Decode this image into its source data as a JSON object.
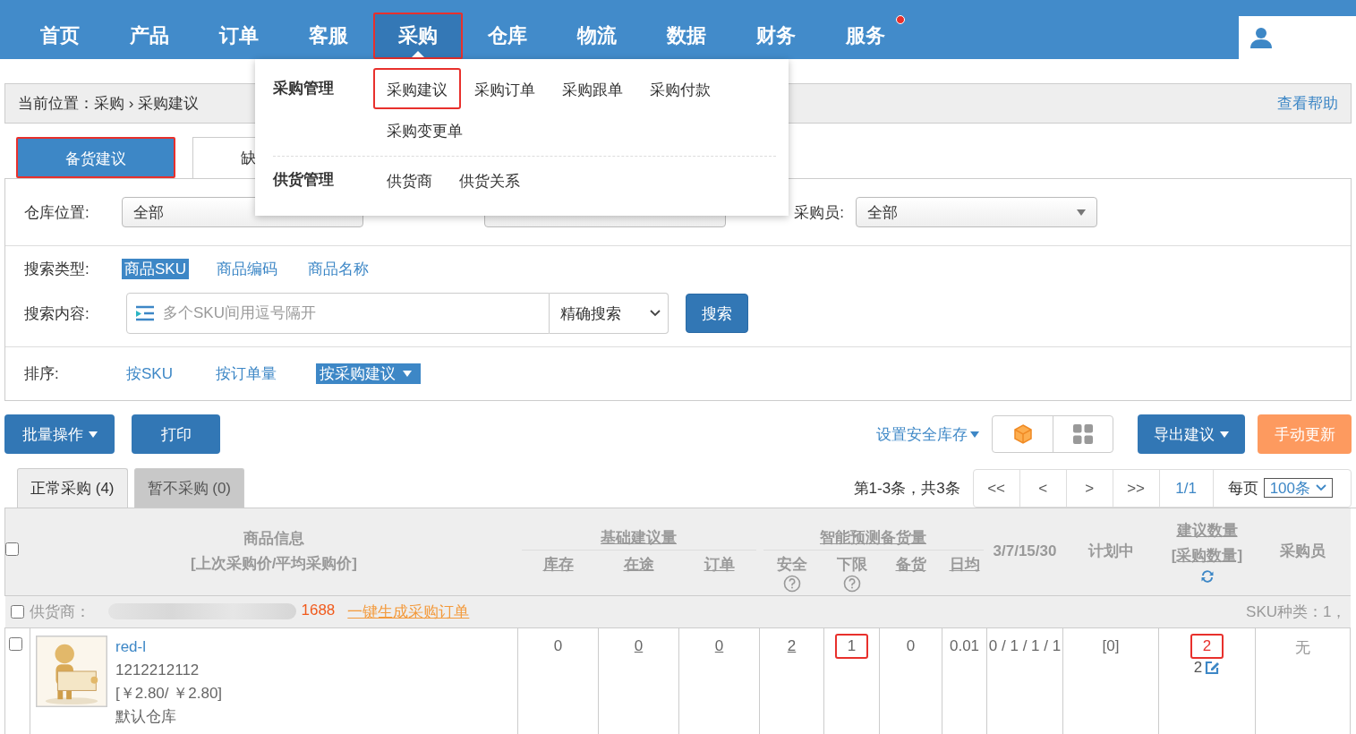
{
  "nav": {
    "items": [
      {
        "label": "首页",
        "selected": false,
        "highlighted": false,
        "dot": false
      },
      {
        "label": "产品",
        "selected": false,
        "highlighted": false,
        "dot": false
      },
      {
        "label": "订单",
        "selected": false,
        "highlighted": false,
        "dot": false
      },
      {
        "label": "客服",
        "selected": false,
        "highlighted": false,
        "dot": false
      },
      {
        "label": "采购",
        "selected": true,
        "highlighted": true,
        "dot": false
      },
      {
        "label": "仓库",
        "selected": false,
        "highlighted": false,
        "dot": false
      },
      {
        "label": "物流",
        "selected": false,
        "highlighted": false,
        "dot": false
      },
      {
        "label": "数据",
        "selected": false,
        "highlighted": false,
        "dot": false
      },
      {
        "label": "财务",
        "selected": false,
        "highlighted": false,
        "dot": false
      },
      {
        "label": "服务",
        "selected": false,
        "highlighted": false,
        "dot": true
      }
    ]
  },
  "menu": {
    "groups": [
      {
        "title": "采购管理",
        "items": [
          {
            "label": "采购建议",
            "highlighted": true
          },
          {
            "label": "采购订单",
            "highlighted": false
          },
          {
            "label": "采购跟单",
            "highlighted": false
          },
          {
            "label": "采购付款",
            "highlighted": false
          },
          {
            "label": "采购变更单",
            "highlighted": false
          }
        ]
      },
      {
        "title": "供货管理",
        "items": [
          {
            "label": "供货商",
            "highlighted": false
          },
          {
            "label": "供货关系",
            "highlighted": false
          }
        ]
      }
    ]
  },
  "breadcrumb": {
    "text": "当前位置：采购 › 采购建议",
    "help": "查看帮助"
  },
  "tabs": [
    {
      "label": "备货建议",
      "selected": true,
      "highlighted": true
    },
    {
      "label": "缺",
      "selected": false,
      "highlighted": false
    }
  ],
  "filters": [
    {
      "label": "仓库位置:",
      "value": "全部"
    },
    {
      "label": "采购员:",
      "value": "全部"
    }
  ],
  "search_type": {
    "label": "搜索类型:",
    "options": [
      {
        "label": "商品SKU",
        "selected": true
      },
      {
        "label": "商品编码",
        "selected": false
      },
      {
        "label": "商品名称",
        "selected": false
      }
    ]
  },
  "search": {
    "label": "搜索内容:",
    "placeholder": "多个SKU间用逗号隔开",
    "mode": "精确搜索",
    "button": "搜索"
  },
  "sort": {
    "label": "排序:",
    "options": [
      {
        "label": "按SKU",
        "selected": false
      },
      {
        "label": "按订单量",
        "selected": false
      },
      {
        "label": "按采购建议",
        "selected": true
      }
    ]
  },
  "toolbar": {
    "batch": "批量操作",
    "print": "打印",
    "safety_stock": "设置安全库存",
    "export": "导出建议",
    "refresh": "手动更新"
  },
  "subtabs": [
    {
      "label": "正常采购 (4)",
      "selected": true
    },
    {
      "label": "暂不采购 (0)",
      "selected": false
    }
  ],
  "pagination": {
    "summary": "第1-3条，共3条",
    "buttons": [
      "<<",
      "<",
      ">",
      ">>"
    ],
    "page": "1/1",
    "per_page_label": "每页",
    "per_page": "100条"
  },
  "table": {
    "header": [
      {
        "kind": "checkbox",
        "checked": false
      },
      {
        "kind": "product",
        "title": "商品信息",
        "subtitle": "[上次采购价/平均采购价]"
      },
      {
        "kind": "group",
        "title": "基础建议量",
        "subheaders": [
          {
            "label": "库存",
            "sortable": true,
            "help": false
          },
          {
            "label": "在途",
            "sortable": true,
            "help": false
          },
          {
            "label": "订单",
            "sortable": true,
            "help": false
          }
        ]
      },
      {
        "kind": "group",
        "title": "智能预测备货量",
        "subheaders": [
          {
            "label": "安全",
            "sortable": false,
            "help": true
          },
          {
            "label": "下限",
            "sortable": false,
            "help": true
          },
          {
            "label": "备货",
            "sortable": true,
            "help": false
          },
          {
            "label": "日均",
            "sortable": true,
            "help": false
          }
        ]
      },
      {
        "kind": "single",
        "label": "3/7/15/30",
        "sortable": false
      },
      {
        "kind": "single",
        "label": "计划中",
        "sortable": false
      },
      {
        "kind": "suggest",
        "label": "建议数量",
        "subtitle": "[采购数量]"
      },
      {
        "kind": "single",
        "label": "采购员",
        "sortable": false
      }
    ],
    "supplier": {
      "checked": false,
      "label": "供货商：",
      "source": "1688",
      "action": "一键生成采购订单",
      "sku_count": "SKU种类：1，"
    },
    "rows": [
      {
        "checked": false,
        "image": {
          "kind": "picture"
        },
        "sku": "red-l",
        "code": "1212212112",
        "price": "[￥2.80/ ￥2.80]",
        "warehouse": "默认仓库",
        "cells": [
          {
            "text": "0",
            "underlined": false,
            "highlighted": false
          },
          {
            "text": "0",
            "underlined": true,
            "highlighted": false
          },
          {
            "text": "0",
            "underlined": true,
            "highlighted": false
          },
          {
            "text": "2",
            "underlined": true,
            "highlighted": false
          },
          {
            "text": "1",
            "underlined": false,
            "highlighted": true
          },
          {
            "text": "0",
            "underlined": false,
            "highlighted": false
          },
          {
            "text": "0.01",
            "underlined": false,
            "highlighted": false
          },
          {
            "text": "0 / 1 / 1 / 1",
            "underlined": false,
            "highlighted": false
          },
          {
            "text": "[0]",
            "underlined": false,
            "highlighted": false
          }
        ],
        "suggested": {
          "value": "2",
          "highlighted": true,
          "purchase": "2"
        },
        "buyer": "无"
      }
    ]
  }
}
